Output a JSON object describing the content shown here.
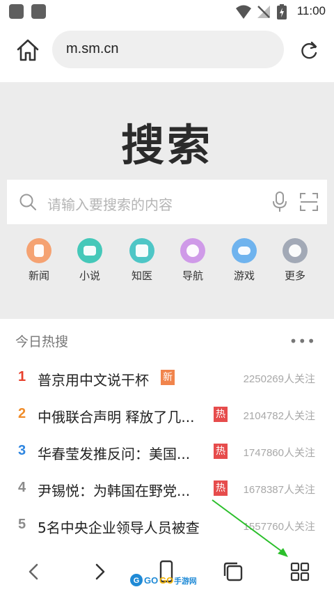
{
  "status_bar": {
    "time": "11:00"
  },
  "browser": {
    "url": "m.sm.cn"
  },
  "search": {
    "title": "搜索",
    "placeholder": "请输入要搜索的内容"
  },
  "shortcuts": [
    {
      "label": "新闻",
      "color": "#f5a272",
      "icon": "news-icon"
    },
    {
      "label": "小说",
      "color": "#45c8b9",
      "icon": "book-icon"
    },
    {
      "label": "知医",
      "color": "#4ec6c6",
      "icon": "medical-icon"
    },
    {
      "label": "导航",
      "color": "#cf9ae8",
      "icon": "compass-icon"
    },
    {
      "label": "游戏",
      "color": "#6fb3ee",
      "icon": "gamepad-icon"
    },
    {
      "label": "更多",
      "color": "#a2a9b6",
      "icon": "chevron-down-icon"
    }
  ],
  "hot": {
    "title": "今日热搜",
    "items": [
      {
        "rank": "1",
        "text": "普京用中文说干杯",
        "badge": "新",
        "count": "2250269人关注",
        "rank_color": "#e8402c",
        "badge_color": "#f1844c"
      },
      {
        "rank": "2",
        "text": "中俄联合声明 释放了几...",
        "badge": "热",
        "count": "2104782人关注",
        "rank_color": "#f08c29",
        "badge_color": "#e64c4c"
      },
      {
        "rank": "3",
        "text": "华春莹发推反问：美国...",
        "badge": "热",
        "count": "1747860人关注",
        "rank_color": "#2f86e0",
        "badge_color": "#e64c4c"
      },
      {
        "rank": "4",
        "text": "尹锡悦：为韩国在野党...",
        "badge": "热",
        "count": "1678387人关注",
        "rank_color": "#8a8a8a",
        "badge_color": "#e64c4c"
      },
      {
        "rank": "5",
        "text": "5名中央企业领导人员被查",
        "badge": "",
        "count": "1557760人关注",
        "rank_color": "#8a8a8a",
        "badge_color": ""
      }
    ]
  },
  "watermark": {
    "text": "GO GO手游网"
  }
}
